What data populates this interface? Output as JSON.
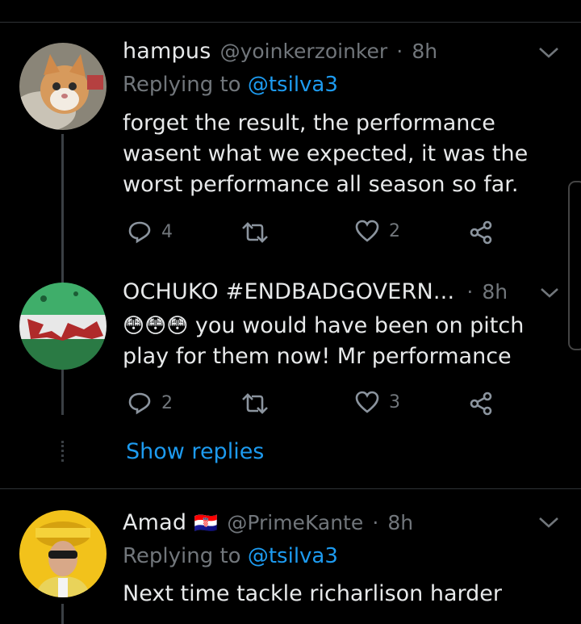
{
  "tweets": [
    {
      "name": "hampus",
      "handle": "@yoinkerzoinker",
      "time": "8h",
      "reply_prefix": "Replying to",
      "reply_to": "@tsilva3",
      "text_lines": [
        "forget the result, the performance",
        "wasent what we expected, it was the",
        "worst performance all season so far."
      ],
      "replies": "4",
      "retweets": "",
      "likes": "2"
    },
    {
      "name": "OCHUKO #ENDBADGOVERN...",
      "time": "8h",
      "emoji": "😳😳😳",
      "text_lines": [
        "you would  have been on pitch",
        "play for them now!  Mr performance"
      ],
      "replies": "2",
      "retweets": "",
      "likes": "3"
    },
    {
      "name": "Amad",
      "flag": "🇭🇷",
      "handle": "@PrimeKante",
      "time": "8h",
      "reply_prefix": "Replying to",
      "reply_to": "@tsilva3",
      "text_lines": [
        "Next time tackle richarlison harder"
      ]
    }
  ],
  "show_replies_label": "Show replies",
  "separator_dot": "·",
  "icons": {
    "reply": "reply-icon",
    "retweet": "retweet-icon",
    "like": "heart-icon",
    "share": "share-icon",
    "menu": "chevron-down-icon"
  },
  "colors": {
    "background": "#000000",
    "text": "#e7e9ea",
    "muted": "#71767b",
    "link": "#1d9bf0",
    "divider": "#2f3336"
  }
}
